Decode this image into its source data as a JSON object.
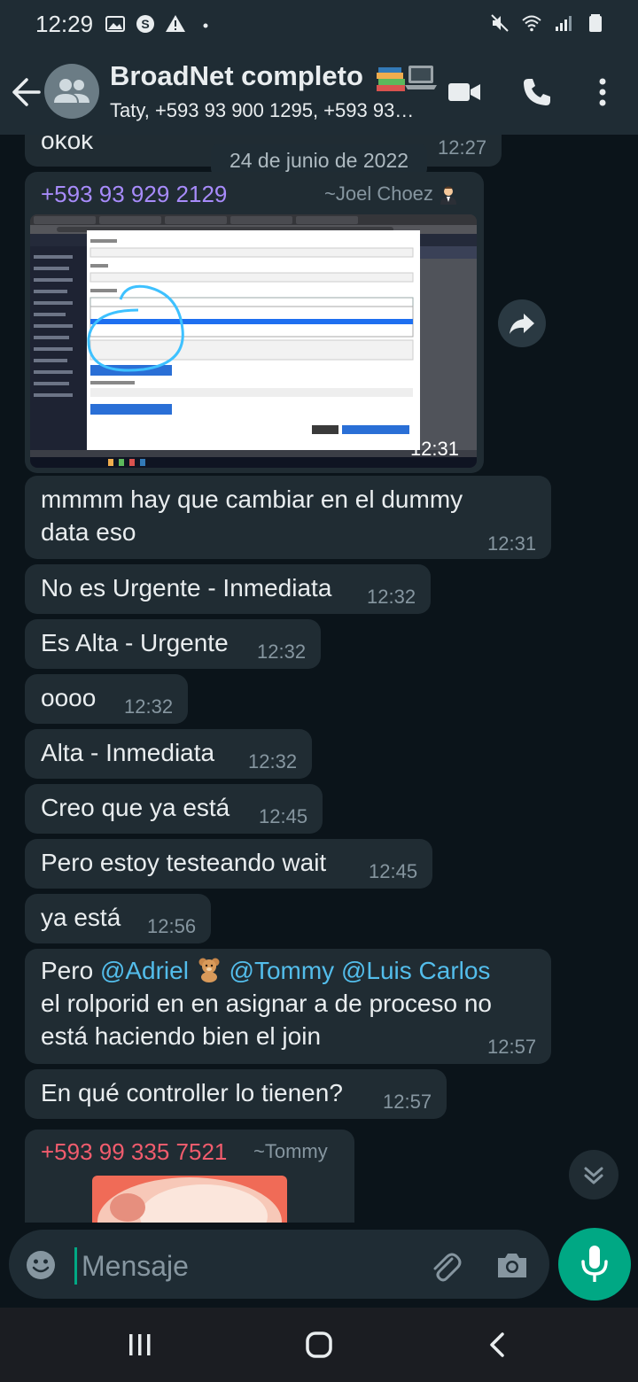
{
  "status": {
    "time": "12:29"
  },
  "header": {
    "title": "BroadNet completo",
    "subtitle": "Taty, +593 93 900 1295, +593 93…"
  },
  "chat": {
    "top_partial": {
      "text": "okok",
      "time": "12:27"
    },
    "date_chip": "24 de junio de 2022",
    "image_message": {
      "sender": "+593 93 929 2129",
      "alias": "~Joel Choez",
      "time": "12:31"
    },
    "messages": [
      {
        "text": "mmmm hay que cambiar en el dummy data eso",
        "time": "12:31"
      },
      {
        "text": "No es Urgente - Inmediata",
        "time": "12:32"
      },
      {
        "text": "Es Alta - Urgente",
        "time": "12:32"
      },
      {
        "text": "oooo",
        "time": "12:32"
      },
      {
        "text": "Alta - Inmediata",
        "time": "12:32"
      },
      {
        "text": "Creo que ya está",
        "time": "12:45"
      },
      {
        "text": "Pero estoy testeando wait",
        "time": "12:45"
      },
      {
        "text": "ya está",
        "time": "12:56"
      }
    ],
    "mention_message": {
      "prefix": "Pero",
      "mention1": "@Adriel",
      "mention2": "@Tommy",
      "mention3": "@Luis Carlos",
      "line2": "el rolporid en en asignar a de proceso no",
      "line3": "está haciendo bien el join",
      "time": "12:57"
    },
    "controller_message": {
      "text": "En qué controller lo tienen?",
      "time": "12:57"
    },
    "last_message": {
      "sender": "+593 99 335 7521",
      "alias": "~Tommy"
    }
  },
  "input": {
    "placeholder": "Mensaje"
  },
  "colors": {
    "background": "#0b141a",
    "bar": "#1f2c34",
    "bubble": "#202c33",
    "accent": "#00a884",
    "mention": "#53bdeb",
    "sender1": "#a78bfa",
    "sender2": "#f15c6d"
  },
  "icons": {
    "app_bar": [
      "back-arrow-icon",
      "group-avatar-icon",
      "video-call-icon",
      "voice-call-icon",
      "more-options-icon"
    ],
    "input_bar": [
      "emoji-icon",
      "attach-icon",
      "camera-icon",
      "mic-icon"
    ],
    "nav": [
      "recent-apps-icon",
      "home-icon",
      "back-icon"
    ]
  }
}
